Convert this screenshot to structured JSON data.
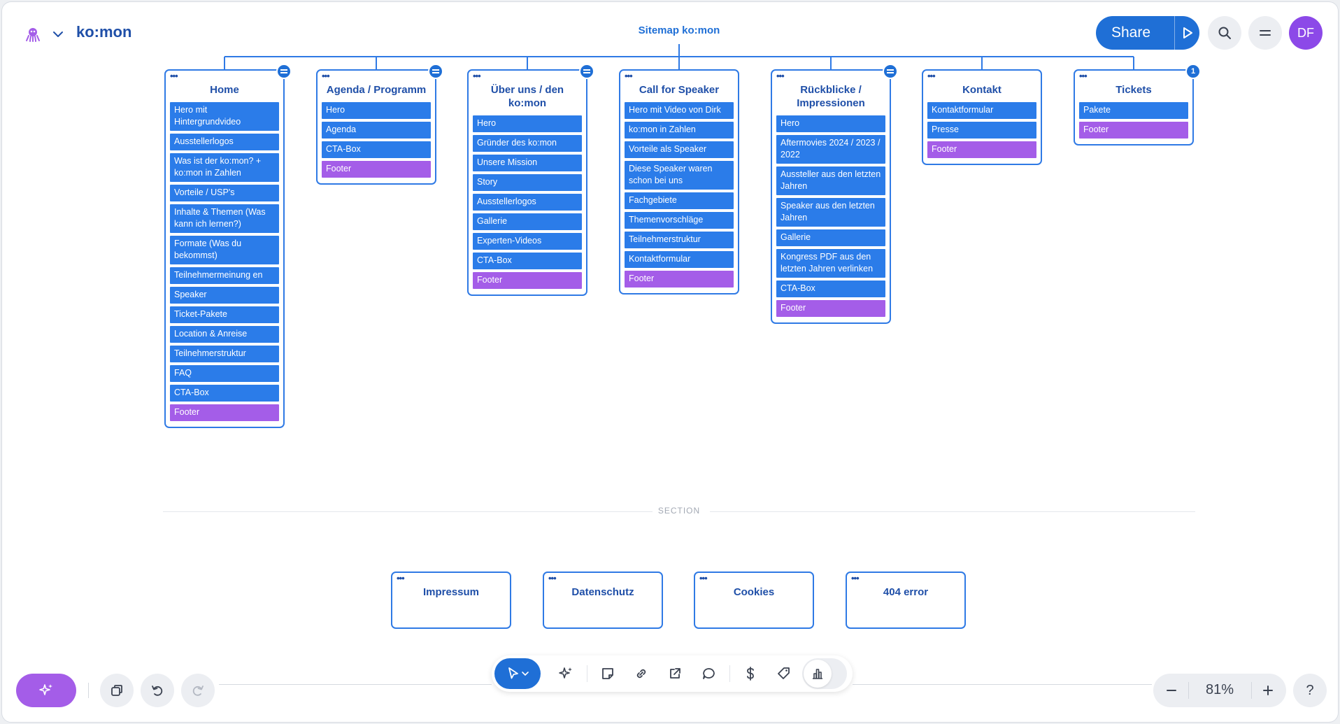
{
  "header": {
    "project_name": "ko:mon",
    "sitemap_title": "Sitemap ko:mon",
    "share_label": "Share",
    "avatar_initials": "DF"
  },
  "colors": {
    "accent": "#1f6fd6",
    "block": "#2b7ce9",
    "footer_block": "#a45de8",
    "avatar": "#8c49e8"
  },
  "icons": {
    "logo": "octopus-logo-icon",
    "brand_menu": "chevron-down-icon",
    "present": "play-icon",
    "search": "search-icon",
    "menu": "hamburger-menu-icon",
    "ai": "sparkles-icon",
    "duplicate": "duplicate-icon",
    "undo": "undo-icon",
    "redo": "redo-icon",
    "select": "cursor-arrow-icon",
    "ai_generate": "sparkles-icon",
    "sticky_note": "sticky-note-icon",
    "link": "link-icon",
    "export": "external-link-icon",
    "comment": "comment-icon",
    "pricing": "dollar-icon",
    "tag": "tag-icon",
    "chart": "bar-chart-icon",
    "zoom_out": "minus-icon",
    "zoom_in": "plus-icon"
  },
  "pages": [
    {
      "title": "Home",
      "badge": "=",
      "blocks": [
        "Hero mit Hintergrundvideo",
        "Ausstellerlogos",
        "Was ist der ko:mon? + ko:mon in Zahlen",
        "Vorteile / USP's",
        "Inhalte & Themen (Was kann ich lernen?)",
        "Formate (Was du bekommst)",
        "Teilnehmermeinung en",
        "Speaker",
        "Ticket-Pakete",
        "Location & Anreise",
        "Teilnehmerstruktur",
        "FAQ",
        "CTA-Box",
        "Footer"
      ]
    },
    {
      "title": "Agenda / Programm",
      "badge": "=",
      "blocks": [
        "Hero",
        "Agenda",
        "CTA-Box",
        "Footer"
      ]
    },
    {
      "title": "Über uns / den ko:mon",
      "badge": "=",
      "blocks": [
        "Hero",
        "Gründer des ko:mon",
        "Unsere Mission",
        "Story",
        "Ausstellerlogos",
        "Gallerie",
        "Experten-Videos",
        "CTA-Box",
        "Footer"
      ]
    },
    {
      "title": "Call for Speaker",
      "badge": "",
      "blocks": [
        "Hero mit Video von Dirk",
        "ko:mon in Zahlen",
        "Vorteile als Speaker",
        "Diese Speaker waren schon bei uns",
        "Fachgebiete",
        "Themenvorschläge",
        "Teilnehmerstruktur",
        "Kontaktformular",
        "Footer"
      ]
    },
    {
      "title": "Rückblicke / Impressionen",
      "badge": "=",
      "blocks": [
        "Hero",
        "Aftermovies 2024 / 2023 / 2022",
        "Aussteller aus den letzten Jahren",
        "Speaker aus den letzten Jahren",
        "Gallerie",
        "Kongress PDF aus den letzten Jahren verlinken",
        "CTA-Box",
        "Footer"
      ]
    },
    {
      "title": "Kontakt",
      "badge": "",
      "blocks": [
        "Kontaktformular",
        "Presse",
        "Footer"
      ]
    },
    {
      "title": "Tickets",
      "badge": "1",
      "blocks": [
        "Pakete",
        "Footer"
      ]
    }
  ],
  "section": {
    "label": "SECTION",
    "pages": [
      "Impressum",
      "Datenschutz",
      "Cookies",
      "404 error"
    ]
  },
  "zoom": {
    "value": "81%"
  },
  "help_label": "?"
}
